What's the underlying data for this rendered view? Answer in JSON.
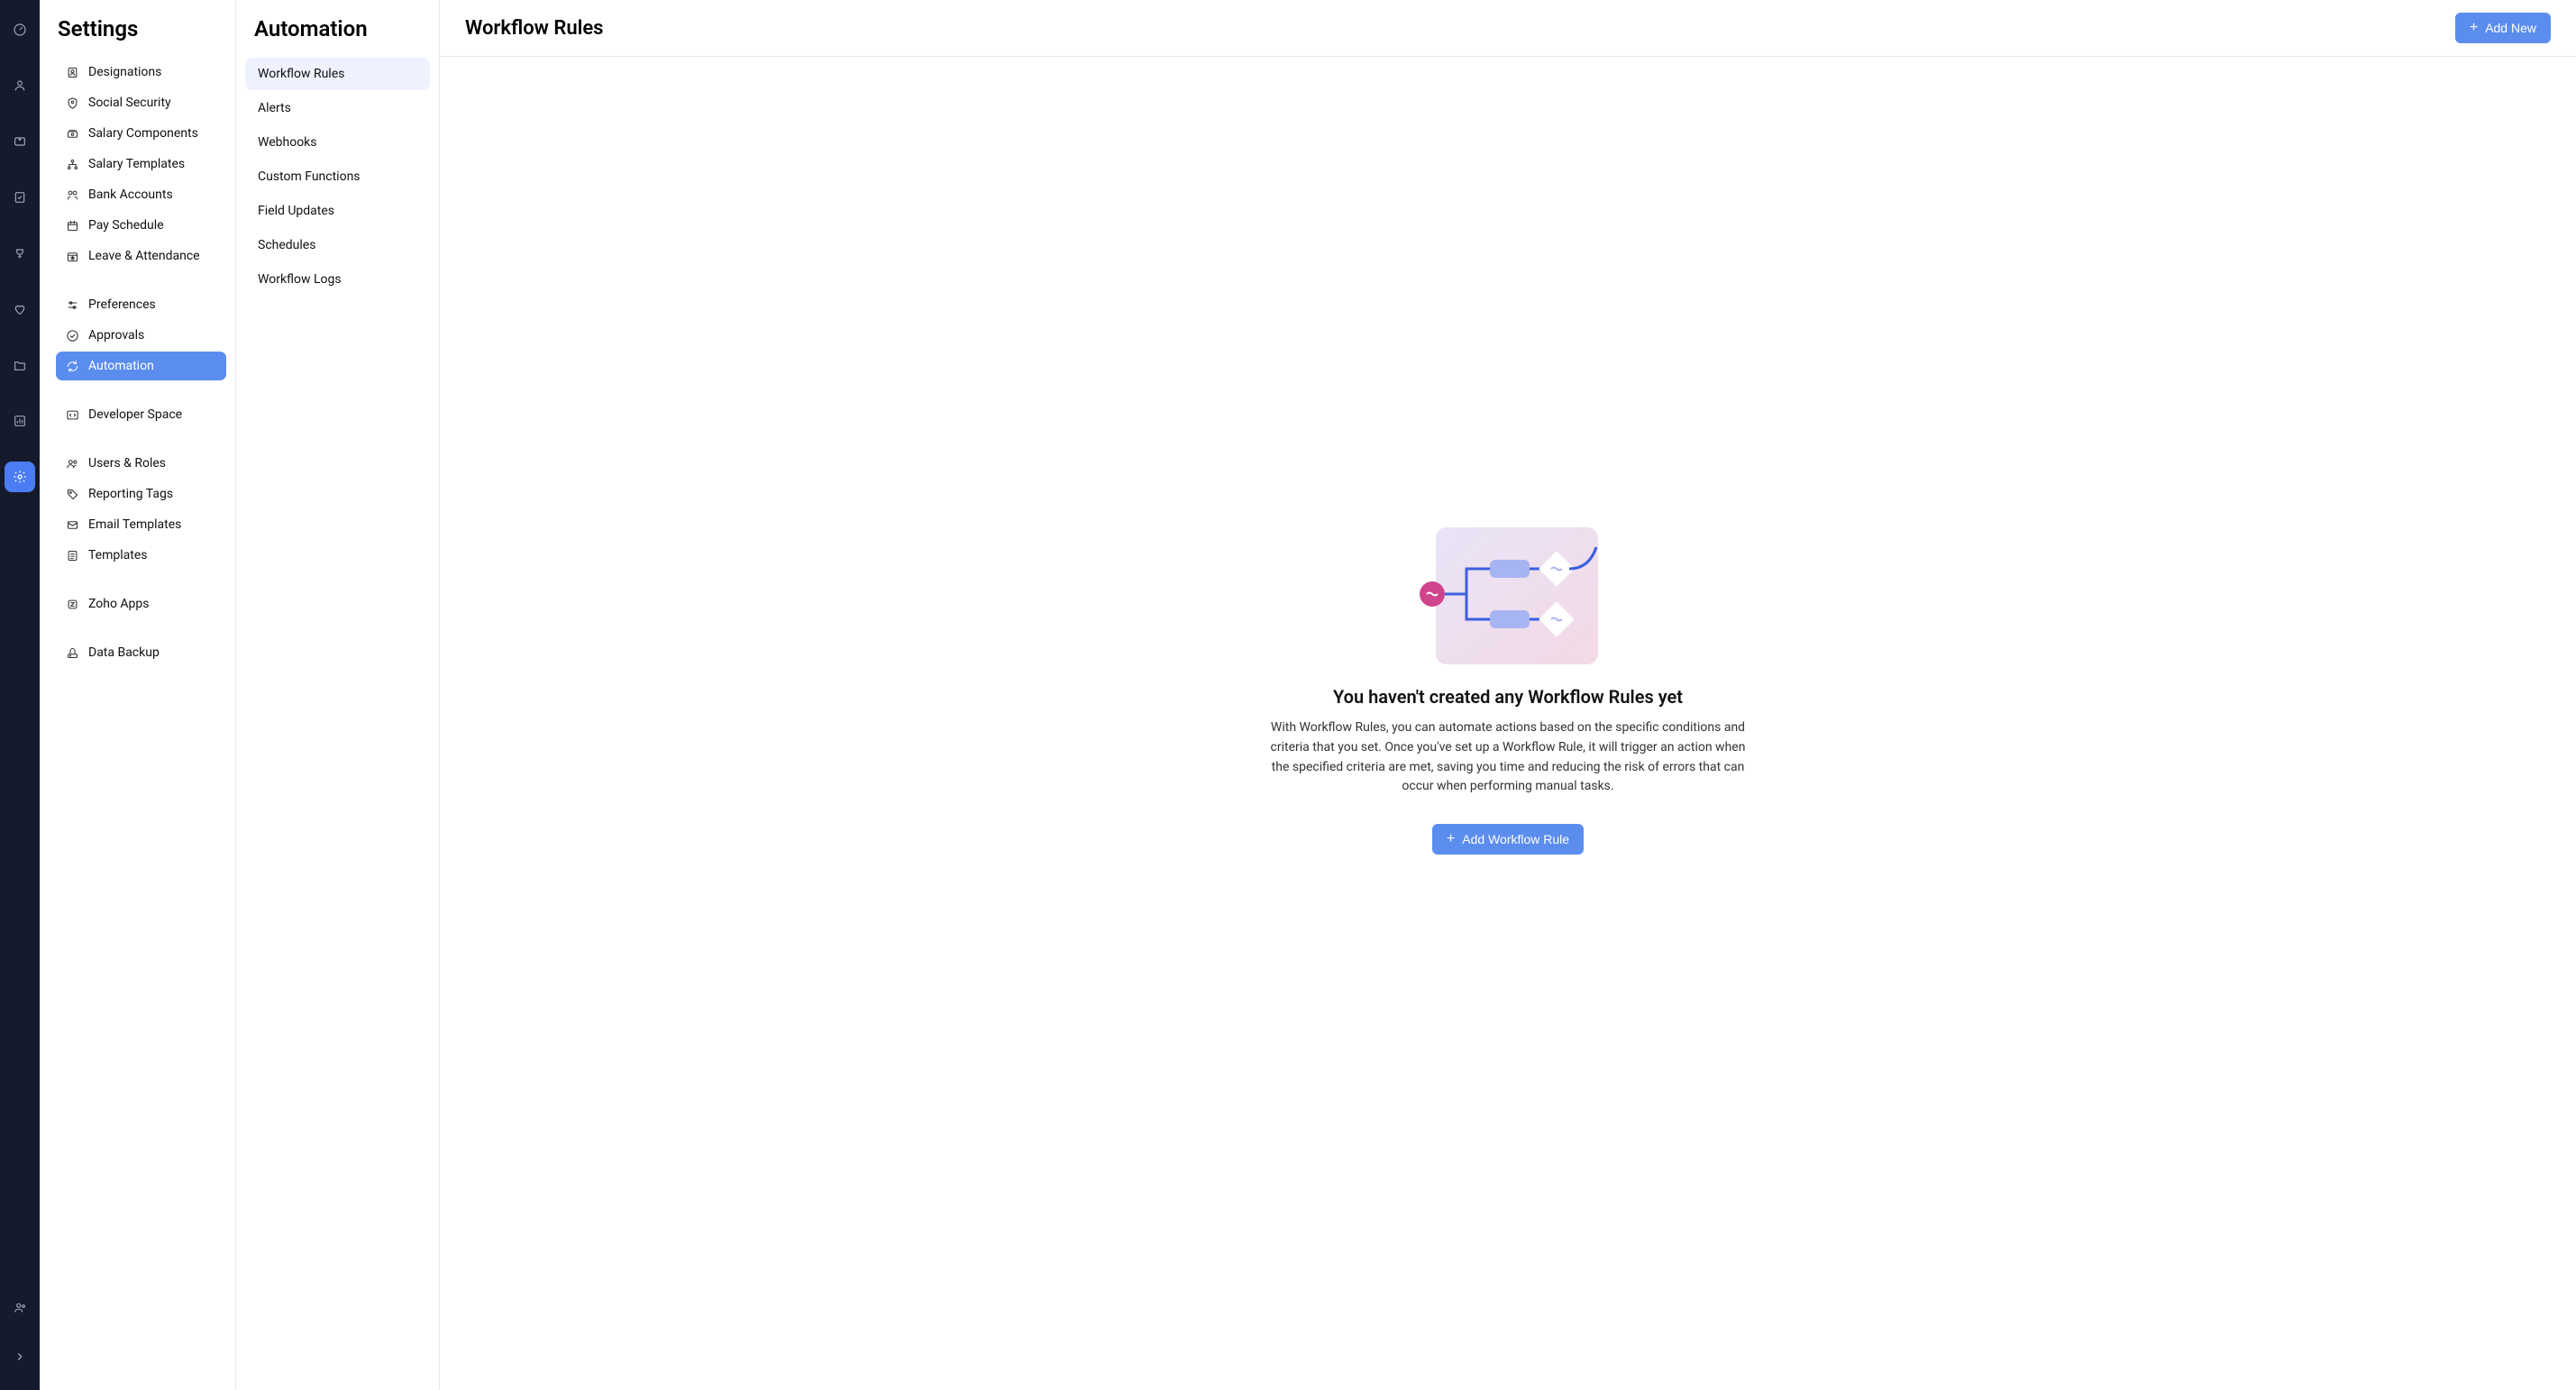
{
  "rail": {
    "icons": [
      {
        "name": "dashboard-icon"
      },
      {
        "name": "people-icon"
      },
      {
        "name": "inbox-icon"
      },
      {
        "name": "approvals-icon"
      },
      {
        "name": "loans-icon"
      },
      {
        "name": "benefits-icon"
      },
      {
        "name": "documents-icon"
      },
      {
        "name": "reports-icon"
      },
      {
        "name": "settings-icon",
        "active": true
      }
    ],
    "bottom": [
      {
        "name": "profile-icon"
      },
      {
        "name": "expand-icon"
      }
    ]
  },
  "settings": {
    "title": "Settings",
    "items": [
      {
        "label": "Designations",
        "icon": "designation"
      },
      {
        "label": "Social Security",
        "icon": "shield-person"
      },
      {
        "label": "Salary Components",
        "icon": "money-stack"
      },
      {
        "label": "Salary Templates",
        "icon": "org"
      },
      {
        "label": "Bank Accounts",
        "icon": "bank"
      },
      {
        "label": "Pay Schedule",
        "icon": "calendar"
      },
      {
        "label": "Leave & Attendance",
        "icon": "leave"
      },
      {
        "spacer": true
      },
      {
        "label": "Preferences",
        "icon": "sliders"
      },
      {
        "label": "Approvals",
        "icon": "check-circle"
      },
      {
        "label": "Automation",
        "icon": "refresh",
        "active": true
      },
      {
        "spacer": true
      },
      {
        "label": "Developer Space",
        "icon": "code"
      },
      {
        "spacer": true
      },
      {
        "label": "Users & Roles",
        "icon": "users"
      },
      {
        "label": "Reporting Tags",
        "icon": "tag"
      },
      {
        "label": "Email Templates",
        "icon": "mail"
      },
      {
        "label": "Templates",
        "icon": "templates"
      },
      {
        "spacer": true
      },
      {
        "label": "Zoho Apps",
        "icon": "zoho"
      },
      {
        "spacer": true
      },
      {
        "label": "Data Backup",
        "icon": "backup"
      }
    ]
  },
  "subnav": {
    "title": "Automation",
    "items": [
      {
        "label": "Workflow Rules",
        "active": true
      },
      {
        "label": "Alerts"
      },
      {
        "label": "Webhooks"
      },
      {
        "label": "Custom Functions"
      },
      {
        "label": "Field Updates"
      },
      {
        "label": "Schedules"
      },
      {
        "label": "Workflow Logs"
      }
    ]
  },
  "main": {
    "title": "Workflow Rules",
    "add_new_label": "Add New",
    "empty": {
      "heading": "You haven't created any Workflow Rules yet",
      "description": "With Workflow Rules, you can automate actions based on the specific conditions and criteria that you set. Once you've set up a Workflow Rule, it will trigger an action when the specified criteria are met, saving you time and reducing the risk of errors that can occur when performing manual tasks.",
      "cta_label": "Add Workflow Rule"
    }
  }
}
